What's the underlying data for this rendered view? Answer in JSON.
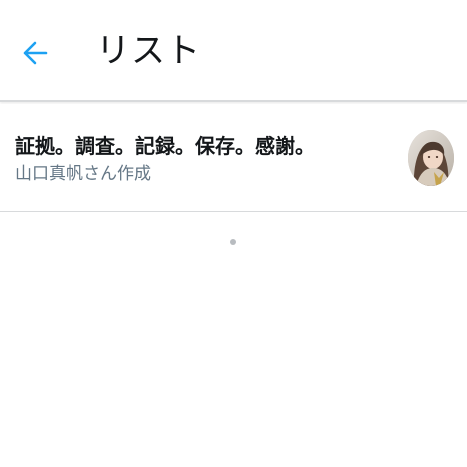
{
  "header": {
    "title": "リスト",
    "back_icon": "arrow-left-icon"
  },
  "lists": [
    {
      "name": "証拠。調査。記録。保存。感謝。",
      "creator": "山口真帆さん作成",
      "avatar_icon": "list-creator-avatar"
    }
  ],
  "loading": {
    "icon": "loading-indicator"
  },
  "colors": {
    "accent": "#1da1f2",
    "text_primary": "#14171a",
    "text_secondary": "#657786",
    "divider": "#d8dadc"
  }
}
